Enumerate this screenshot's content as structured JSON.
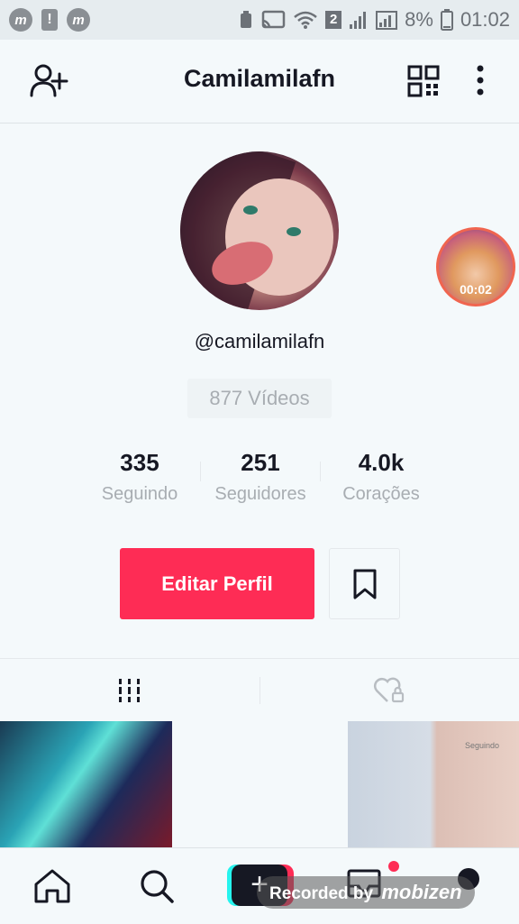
{
  "status_bar": {
    "notif_icons": [
      "mobizen-icon",
      "warning-icon",
      "mobizen-icon"
    ],
    "sim_label": "2",
    "battery": "8%",
    "time": "01:02"
  },
  "header": {
    "title": "Camilamilafn",
    "icons": [
      "add-user-icon",
      "qr-code-icon",
      "more-vertical-icon"
    ]
  },
  "profile": {
    "username": "@camilamilafn",
    "videos_count": "877 Vídeos",
    "story_duration": "00:02"
  },
  "stats": [
    {
      "value": "335",
      "label": "Seguindo"
    },
    {
      "value": "251",
      "label": "Seguidores"
    },
    {
      "value": "4.0k",
      "label": "Corações"
    }
  ],
  "actions": {
    "edit_label": "Editar Perfil",
    "accent_color": "#fe2c55"
  },
  "tabs": [
    "videos-grid-icon",
    "liked-locked-icon"
  ],
  "thumbnail_text": "Seguindo",
  "bottom_nav": [
    "home-icon",
    "search-icon",
    "create-icon",
    "inbox-icon",
    "profile-icon"
  ],
  "watermark": {
    "prefix": "Recorded by",
    "brand": "mobizen"
  }
}
